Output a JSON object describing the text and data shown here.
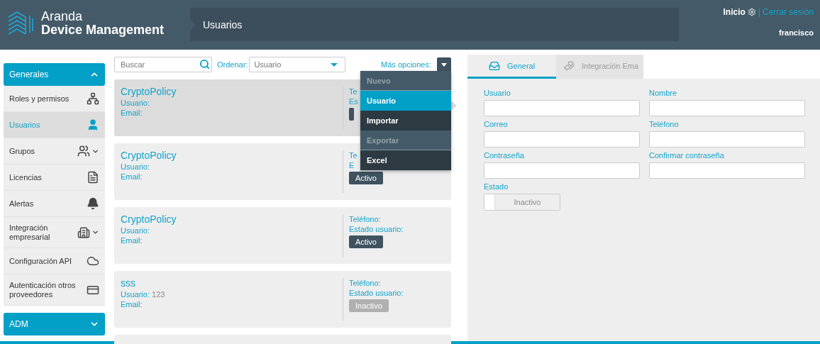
{
  "header": {
    "brand_top": "Aranda",
    "brand_bottom": "Device Management",
    "page_title": "Usuarios",
    "home_link": "Inicio",
    "separator": "|",
    "logout_link": "Cerrar sesión",
    "user": "francisco"
  },
  "sidebar": {
    "sections": [
      {
        "title": "Generales",
        "expanded": true,
        "items": [
          {
            "label": "Roles y permisos",
            "selected": false,
            "expandable": false
          },
          {
            "label": "Usuarios",
            "selected": true,
            "expandable": false
          },
          {
            "label": "Grupos",
            "selected": false,
            "expandable": true
          },
          {
            "label": "Licencias",
            "selected": false,
            "expandable": false
          },
          {
            "label": "Alertas",
            "selected": false,
            "expandable": false
          },
          {
            "label": "Integración empresarial",
            "selected": false,
            "expandable": true
          },
          {
            "label": "Configuración API",
            "selected": false,
            "expandable": false
          },
          {
            "label": "Autenticación otros proveedores",
            "selected": false,
            "expandable": false
          }
        ]
      },
      {
        "title": "ADM",
        "expanded": false
      }
    ]
  },
  "toolbar": {
    "search": {
      "placeholder": "Buscar"
    },
    "sort_label": "Ordenar:",
    "sort": {
      "value": "Usuario"
    },
    "more_label": "Más opciones:"
  },
  "menu": {
    "open": true,
    "items": [
      {
        "kind": "header",
        "label": "Nuevo",
        "selected": false
      },
      {
        "kind": "item",
        "label": "Usuario",
        "selected": true
      },
      {
        "kind": "item",
        "label": "Importar",
        "selected": false
      },
      {
        "kind": "header",
        "label": "Exportar",
        "selected": false
      },
      {
        "kind": "item",
        "label": "Excel",
        "selected": false
      }
    ]
  },
  "cards": [
    {
      "kind": "user",
      "name": "CryptoPolicy",
      "user_label": "Usuario:",
      "email_label": "Email:",
      "phone_label": "Te",
      "status_label": "Es",
      "status": {
        "active": true
      },
      "selected": true
    },
    {
      "kind": "user",
      "name": "CryptoPolicy",
      "user_label": "Usuario:",
      "email_label": "Email:",
      "phone_label": "Te",
      "status_label": "E",
      "status": {
        "active": true,
        "label": "Activo"
      },
      "selected": false
    },
    {
      "kind": "user",
      "name": "CryptoPolicy",
      "user_label": "Usuario:",
      "email_label": "Email:",
      "phone_label": "Teléfono:",
      "status_label": "Estado usuario:",
      "status": {
        "active": true,
        "label": "Activo"
      },
      "selected": false
    },
    {
      "kind": "user",
      "name": "sss",
      "user_label": "Usuario:",
      "user_value": "123",
      "email_label": "Email:",
      "phone_label": "Teléfono:",
      "status_label": "Estado usuario:",
      "status": {
        "active": false,
        "label": "Inactivo"
      },
      "selected": false
    },
    {
      "kind": "partial",
      "selected": false
    }
  ],
  "form": {
    "tabs": [
      {
        "label": "General",
        "selected": true
      },
      {
        "label": "Integración Ema",
        "selected": false
      }
    ],
    "fields": [
      {
        "label": "Usuario"
      },
      {
        "label": "Nombre"
      },
      {
        "label": "Correo"
      },
      {
        "label": "Teléfono"
      },
      {
        "label": "Contraseña"
      },
      {
        "label": "Confirmar contraseña"
      }
    ],
    "status": {
      "label": "Estado",
      "toggle": {
        "on": false,
        "label": "Inactivo"
      }
    }
  }
}
